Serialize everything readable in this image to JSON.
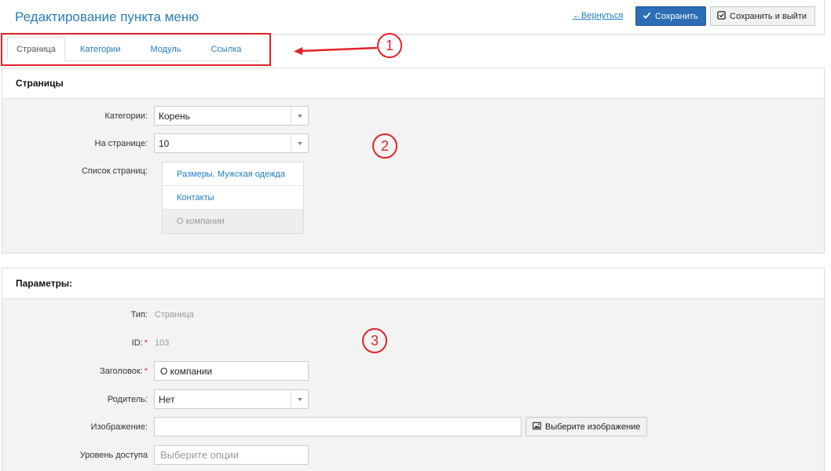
{
  "header": {
    "title": "Редактирование пункта меню",
    "back_label": "←Вернуться",
    "save_label": "Сохранить",
    "save_exit_label": "Сохранить и выйти"
  },
  "tabs": [
    {
      "label": "Страница",
      "active": true
    },
    {
      "label": "Категории",
      "active": false
    },
    {
      "label": "Модуль",
      "active": false
    },
    {
      "label": "Ссылка",
      "active": false
    }
  ],
  "markers": [
    "1",
    "2",
    "3"
  ],
  "pages_panel": {
    "title": "Страницы",
    "category_label": "Категории:",
    "category_value": "Корень",
    "per_page_label": "На странице:",
    "per_page_value": "10",
    "list_label": "Список страниц:",
    "list": [
      {
        "label": "Размеры. Мужская одежда",
        "selected": false
      },
      {
        "label": "Контакты",
        "selected": false
      },
      {
        "label": "О компании",
        "selected": true
      }
    ]
  },
  "params_panel": {
    "title": "Параметры:",
    "type_label": "Тип:",
    "type_value": "Страница",
    "id_label": "ID:",
    "id_value": "103",
    "title_label": "Заголовок:",
    "title_value": "О компании",
    "parent_label": "Родитель:",
    "parent_value": "Нет",
    "image_label": "Изображение:",
    "image_value": "",
    "image_button": "Выберите изображение",
    "access_label": "Уровень доступа",
    "access_placeholder": "Выберите опции",
    "required_mark": "*"
  },
  "colors": {
    "accent": "#2a7cb8",
    "link": "#1f7bc1",
    "primary_button": "#2d6db5",
    "annotation": "#e2222a",
    "panel_bg": "#f3f3f3"
  },
  "icons": {
    "save": "check-icon",
    "save_exit": "check-square-icon",
    "image": "image-icon"
  }
}
